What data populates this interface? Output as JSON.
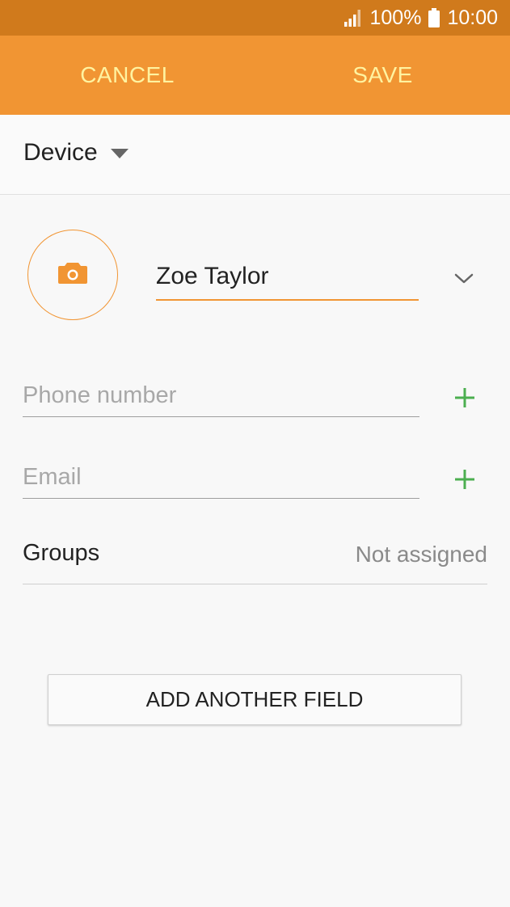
{
  "status_bar": {
    "battery_percent": "100%",
    "time": "10:00",
    "signal_icon": "signal-icon",
    "battery_icon": "battery-icon"
  },
  "app_bar": {
    "cancel_label": "CANCEL",
    "save_label": "SAVE"
  },
  "storage": {
    "selected": "Device",
    "icon": "chevron-down-icon"
  },
  "contact": {
    "photo_icon": "camera-icon",
    "name_value": "Zoe Taylor",
    "expand_icon": "chevron-down-icon"
  },
  "fields": {
    "phone_placeholder": "Phone number",
    "email_placeholder": "Email",
    "add_icon": "plus-icon"
  },
  "groups": {
    "label": "Groups",
    "value": "Not assigned"
  },
  "add_field_button": {
    "label": "ADD ANOTHER FIELD"
  },
  "colors": {
    "status_bar": "#d07a1c",
    "app_bar": "#f19533",
    "action_text": "#fff3a0",
    "accent": "#f19533",
    "add_icon": "#4caf50"
  }
}
